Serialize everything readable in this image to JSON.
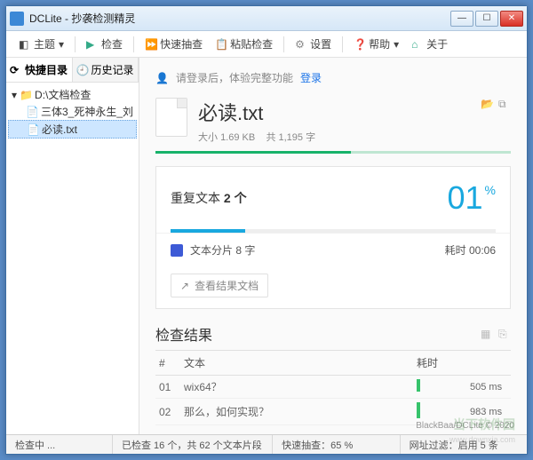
{
  "window": {
    "title": "DCLite - 抄袭检测精灵"
  },
  "toolbar": {
    "theme": "主题",
    "check": "检查",
    "quick": "快速抽查",
    "paste": "粘贴检查",
    "settings": "设置",
    "help": "帮助",
    "about": "关于"
  },
  "tabs": {
    "quickdir": "快捷目录",
    "history": "历史记录"
  },
  "tree": {
    "root": "D:\\文档检查",
    "items": [
      "三体3_死神永生_刘",
      "必读.txt"
    ]
  },
  "login": {
    "prompt": "请登录后，体验完整功能",
    "link": "登录"
  },
  "file": {
    "name": "必读.txt",
    "size_label": "大小",
    "size": "1.69 KB",
    "chars_label": "共",
    "chars": "1,195 字"
  },
  "dup": {
    "label": "重复文本",
    "count": "2 个",
    "pct": "01",
    "pct_unit": "%"
  },
  "shard": {
    "label": "文本分片 8 字",
    "time_label": "耗时",
    "time": "00:06"
  },
  "viewdoc": "查看结果文档",
  "results": {
    "title": "检查结果",
    "col_num": "#",
    "col_text": "文本",
    "col_time": "耗时",
    "rows": [
      {
        "n": "01",
        "text": "wix64？",
        "ms": "505 ms"
      },
      {
        "n": "02",
        "text": "那么，如何实现？",
        "ms": "983 ms"
      }
    ]
  },
  "copyright": "BlackBaa/DCLite © 2020",
  "status": {
    "checking": "检查中 ...",
    "counted": "已检查 16 个，共 62 个文本片段",
    "quickpct": "快速抽查：65 %",
    "filter": "网址过滤：启用 5 条"
  },
  "watermark": {
    "main": "当下软件园",
    "sub": "www.downxia.com"
  }
}
